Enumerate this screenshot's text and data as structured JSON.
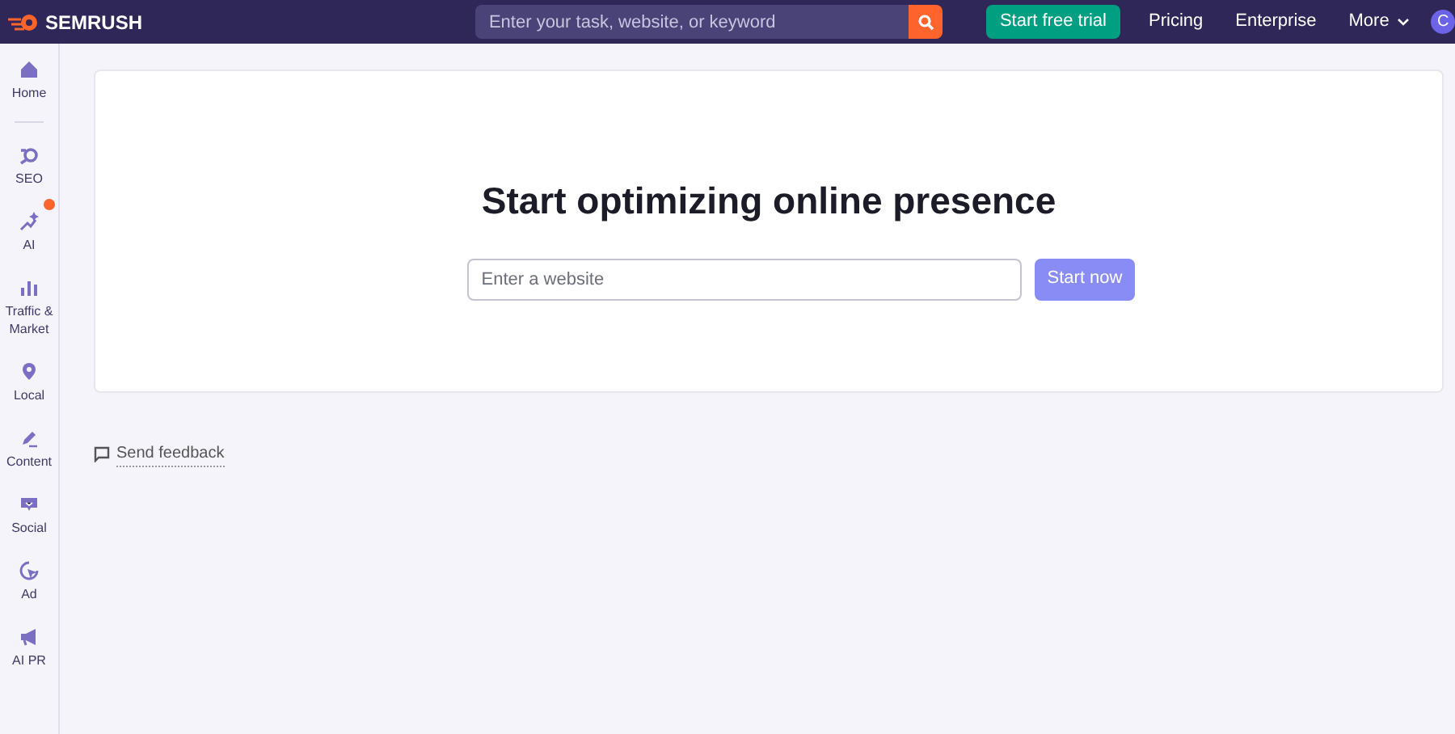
{
  "topbar": {
    "logo": "SEMRUSH",
    "search": {
      "placeholder": "Enter your task, website, or keyword"
    },
    "trial_button": "Start free trial",
    "links": [
      "Pricing",
      "Enterprise",
      "More"
    ],
    "avatar": "C"
  },
  "sidebar": {
    "items": [
      {
        "label": "Home",
        "notification": false
      },
      {
        "label": "SEO",
        "notification": false
      },
      {
        "label": "AI",
        "notification": true
      },
      {
        "label": "Traffic & Market",
        "notification": false
      },
      {
        "label": "Local",
        "notification": false
      },
      {
        "label": "Content",
        "notification": false
      },
      {
        "label": "Social",
        "notification": false
      },
      {
        "label": "Ad",
        "notification": false
      },
      {
        "label": "AI PR",
        "notification": false
      }
    ]
  },
  "main": {
    "title": "Start optimizing online presence",
    "website_field": {
      "placeholder": "Enter a website"
    },
    "start_button": "Start now",
    "feedback_link": "Send feedback"
  }
}
